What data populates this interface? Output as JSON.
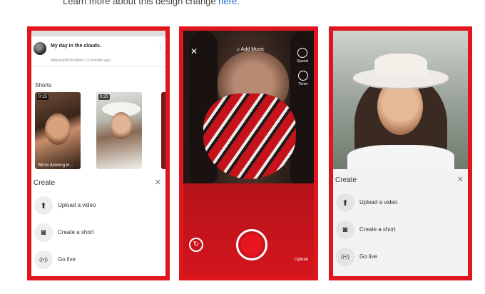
{
  "intro": {
    "text": "Learn more about this design change ",
    "link": "here",
    "end": "."
  },
  "panel1": {
    "video_title": "My day in the clouds.",
    "video_meta": "AllAroundTheWhirl • 2 months ago",
    "shorts_label": "Shorts",
    "shorts": [
      {
        "duration": "0:15",
        "caption": "We're dancing in..."
      },
      {
        "duration": "0:25",
        "caption": ""
      }
    ],
    "sheet": {
      "title": "Create",
      "close": "✕",
      "items": [
        {
          "label": "Upload a video",
          "icon": "upload-icon",
          "glyph": "⬆"
        },
        {
          "label": "Create a short",
          "icon": "camera-icon",
          "glyph": "◙"
        },
        {
          "label": "Go live",
          "icon": "live-icon",
          "glyph": "((•))"
        }
      ]
    }
  },
  "panel2": {
    "close": "✕",
    "add_music": "♫ Add Music",
    "speed_label": "Speed",
    "timer_label": "Timer",
    "upload_label": "Upload",
    "record_color": "#e7161e"
  },
  "panel3": {
    "sheet": {
      "title": "Create",
      "close": "✕",
      "items": [
        {
          "label": "Upload a video",
          "icon": "upload-icon",
          "glyph": "⬆"
        },
        {
          "label": "Create a short",
          "icon": "camera-icon",
          "glyph": "◙"
        },
        {
          "label": "Go live",
          "icon": "live-icon",
          "glyph": "((•))"
        }
      ]
    }
  },
  "colors": {
    "frame": "#e0161e",
    "link": "#1a66d9"
  }
}
